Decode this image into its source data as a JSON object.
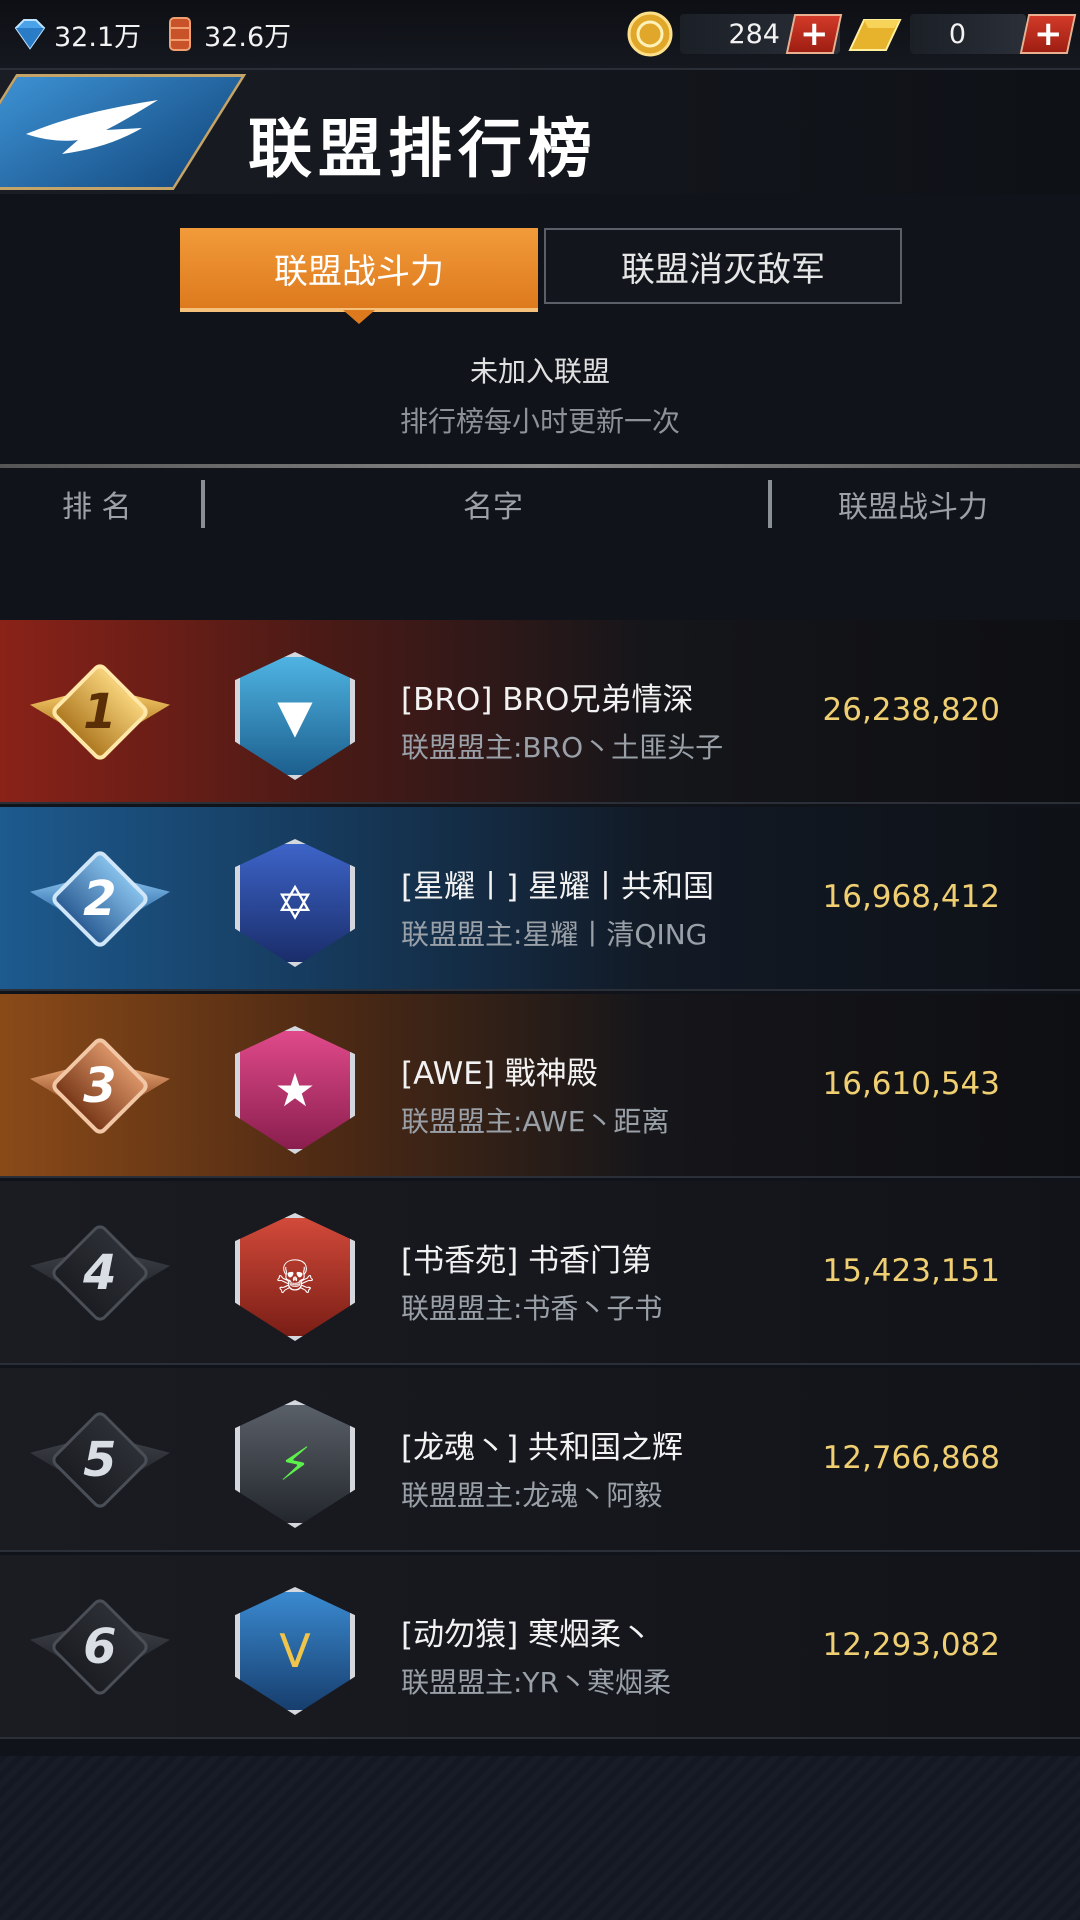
{
  "topbar": {
    "diamond": "32.1万",
    "oil": "32.6万",
    "coin": "284",
    "gold": "0",
    "plus": "+"
  },
  "header": {
    "title": "联盟排行榜"
  },
  "tabs": [
    {
      "label": "联盟战斗力",
      "active": true
    },
    {
      "label": "联盟消灭敌军",
      "active": false
    }
  ],
  "status": {
    "alliance_state": "未加入联盟",
    "update_note": "排行榜每小时更新一次"
  },
  "columns": {
    "rank": "排 名",
    "name": "名字",
    "power": "联盟战斗力"
  },
  "rows": [
    {
      "rank": "1",
      "name": "[BRO] BRO兄弟情深",
      "leader": "联盟盟主:BRO丶土匪头子",
      "power": "26,238,820",
      "emblem_icon": "winged-blue-shield-icon",
      "emblem_glyph": "▼",
      "emblem_color": "#2f9bd0"
    },
    {
      "rank": "2",
      "name": "[星耀丨] 星耀丨共和国",
      "leader": "联盟盟主:星耀丨清QING",
      "power": "16,968,412",
      "emblem_icon": "blue-hexagram-triangle-icon",
      "emblem_glyph": "✡",
      "emblem_color": "#2b4aa0"
    },
    {
      "rank": "3",
      "name": "[AWE] 戰神殿",
      "leader": "联盟盟主:AWE丶距离",
      "power": "16,610,543",
      "emblem_icon": "pink-star-shield-icon",
      "emblem_glyph": "★",
      "emblem_color": "#c8306e"
    },
    {
      "rank": "4",
      "name": "[书香苑] 书香门第",
      "leader": "联盟盟主:书香丶子书",
      "power": "15,423,151",
      "emblem_icon": "skull-winged-shield-icon",
      "emblem_glyph": "☠",
      "emblem_color": "#b8352a"
    },
    {
      "rank": "5",
      "name": "[龙魂丶] 共和国之辉",
      "leader": "联盟盟主:龙魂丶阿毅",
      "power": "12,766,868",
      "emblem_icon": "green-lightning-shield-icon",
      "emblem_glyph": "⚡",
      "emblem_color": "#3a9a3a"
    },
    {
      "rank": "6",
      "name": "[动勿猿] 寒烟柔丶",
      "leader": "联盟盟主:YR丶寒烟柔",
      "power": "12,293,082",
      "emblem_icon": "blue-chevron-shield-icon",
      "emblem_glyph": "V",
      "emblem_color": "#2e6fb0"
    }
  ],
  "colors": {
    "accent": "#e8862a",
    "power": "#f0cf72"
  }
}
